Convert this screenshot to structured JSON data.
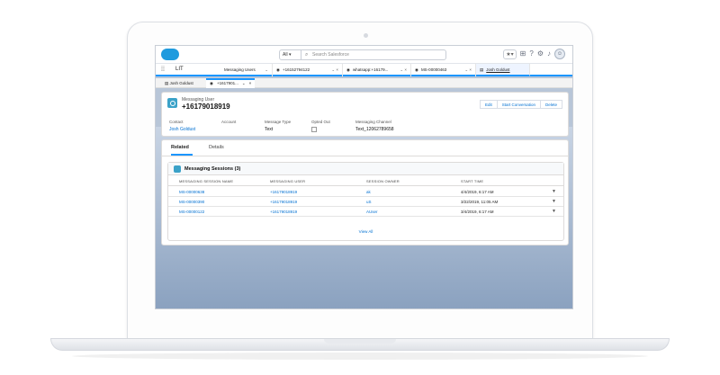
{
  "header": {
    "search_scope": "All",
    "search_placeholder": "Search Salesforce",
    "favorites_label": "★▾"
  },
  "nav": {
    "app_name": "LIT",
    "tabs": [
      {
        "label": "Messaging Users"
      },
      {
        "label": "+16152794122"
      },
      {
        "label": "whatsapp:+16179..."
      },
      {
        "label": "MS-00000463"
      },
      {
        "label": "Josh Goldust"
      }
    ]
  },
  "subtabs": {
    "first": "Josh Goldust",
    "second": "+1617901..."
  },
  "record": {
    "type": "Messaging User",
    "name": "+16179018919",
    "buttons": {
      "edit": "Edit",
      "start": "Start Conversation",
      "delete": "Delete"
    },
    "fields": {
      "contact_label": "Contact",
      "contact_value": "Josh Goldust",
      "account_label": "Account",
      "message_type_label": "Message Type",
      "message_type_value": "Text",
      "opted_out_label": "Opted Out",
      "channel_label": "Messaging Channel",
      "channel_value": "Text_12062789658"
    }
  },
  "related": {
    "tab_related": "Related",
    "tab_details": "Details",
    "list_title": "Messaging Sessions (3)",
    "columns": [
      "MESSAGING SESSION NAME",
      "MESSAGING USER",
      "SESSION OWNER",
      "START TIME"
    ],
    "rows": [
      {
        "name": "MS-00000638",
        "user": "+16179018919",
        "owner": "ak",
        "start": "4/4/2019, 6:17 AM"
      },
      {
        "name": "MS-00000390",
        "user": "+16179018919",
        "owner": "uS",
        "start": "3/22/2019, 11:05 AM"
      },
      {
        "name": "MS-00000122",
        "user": "+16179018919",
        "owner": "AUser",
        "start": "3/4/2019, 6:17 AM"
      }
    ],
    "view_all": "View All"
  }
}
